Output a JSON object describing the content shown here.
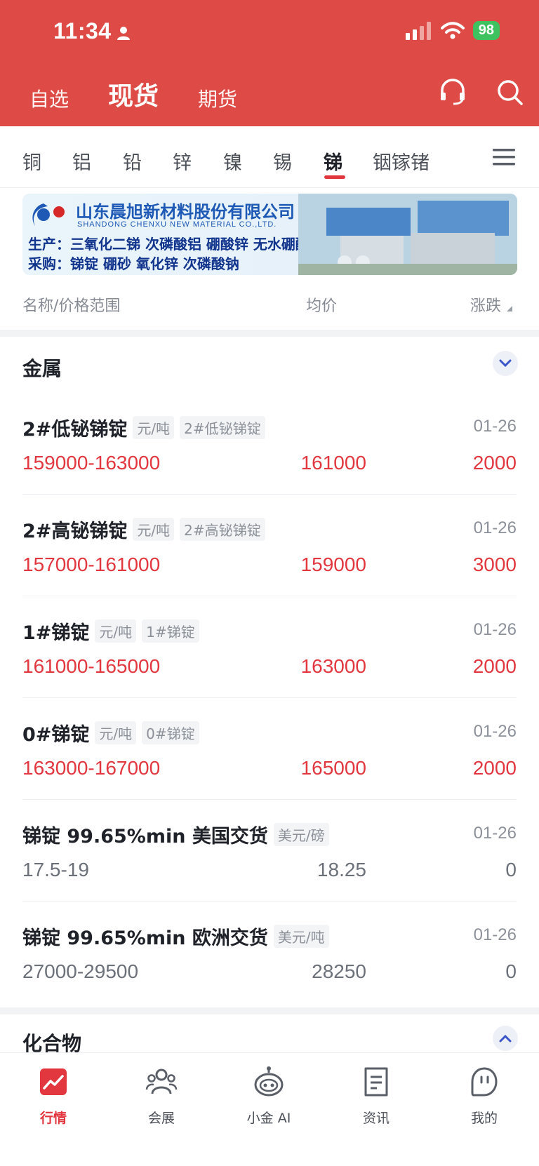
{
  "status": {
    "time": "11:34",
    "battery": "98"
  },
  "header": {
    "tabs": [
      {
        "label": "自选",
        "active": false
      },
      {
        "label": "现货",
        "active": true
      },
      {
        "label": "期货",
        "active": false
      }
    ],
    "icons": [
      "headset-icon",
      "search-icon"
    ]
  },
  "categories": {
    "items": [
      "铜",
      "铝",
      "铅",
      "锌",
      "镍",
      "锡",
      "锑",
      "铟镓锗"
    ],
    "active": "锑"
  },
  "banner": {
    "company": "山东晨旭新材料股份有限公司",
    "company_en": "SHANDONG CHENXU NEW MATERIAL CO.,LTD.",
    "line1": "生产：三氧化二锑  次磷酸铝  硼酸锌  无水硼酸锌",
    "line2": "采购：锑锭 硼砂 氧化锌 次磷酸钠"
  },
  "columns": {
    "name": "名称/价格范围",
    "avg": "均价",
    "change": "涨跌"
  },
  "section": {
    "title": "金属"
  },
  "rows": [
    {
      "name": "2#低铋锑锭",
      "unit": "元/吨",
      "tag": "2#低铋锑锭",
      "date": "01-26",
      "range": "159000-163000",
      "avg": "161000",
      "change": "2000"
    },
    {
      "name": "2#高铋锑锭",
      "unit": "元/吨",
      "tag": "2#高铋锑锭",
      "date": "01-26",
      "range": "157000-161000",
      "avg": "159000",
      "change": "3000"
    },
    {
      "name": "1#锑锭",
      "unit": "元/吨",
      "tag": "1#锑锭",
      "date": "01-26",
      "range": "161000-165000",
      "avg": "163000",
      "change": "2000"
    },
    {
      "name": "0#锑锭",
      "unit": "元/吨",
      "tag": "0#锑锭",
      "date": "01-26",
      "range": "163000-167000",
      "avg": "165000",
      "change": "2000"
    },
    {
      "name": "锑锭 99.65%min 美国交货",
      "unit": "美元/磅",
      "tag": "",
      "date": "01-26",
      "range": "17.5-19",
      "avg": "18.25",
      "change": "0"
    },
    {
      "name": "锑锭 99.65%min 欧洲交货",
      "unit": "美元/吨",
      "tag": "",
      "date": "01-26",
      "range": "27000-29500",
      "avg": "28250",
      "change": "0"
    }
  ],
  "section2": {
    "title": "化合物"
  },
  "tabbar": [
    {
      "label": "行情",
      "icon": "market-icon",
      "active": true
    },
    {
      "label": "会展",
      "icon": "people-icon",
      "active": false
    },
    {
      "label": "小金 AI",
      "icon": "robot-icon",
      "active": false
    },
    {
      "label": "资讯",
      "icon": "news-icon",
      "active": false
    },
    {
      "label": "我的",
      "icon": "profile-icon",
      "active": false
    }
  ],
  "colors": {
    "header_red": "#de4a45",
    "price_red": "#e2373f",
    "battery_green": "#3ec25f"
  }
}
